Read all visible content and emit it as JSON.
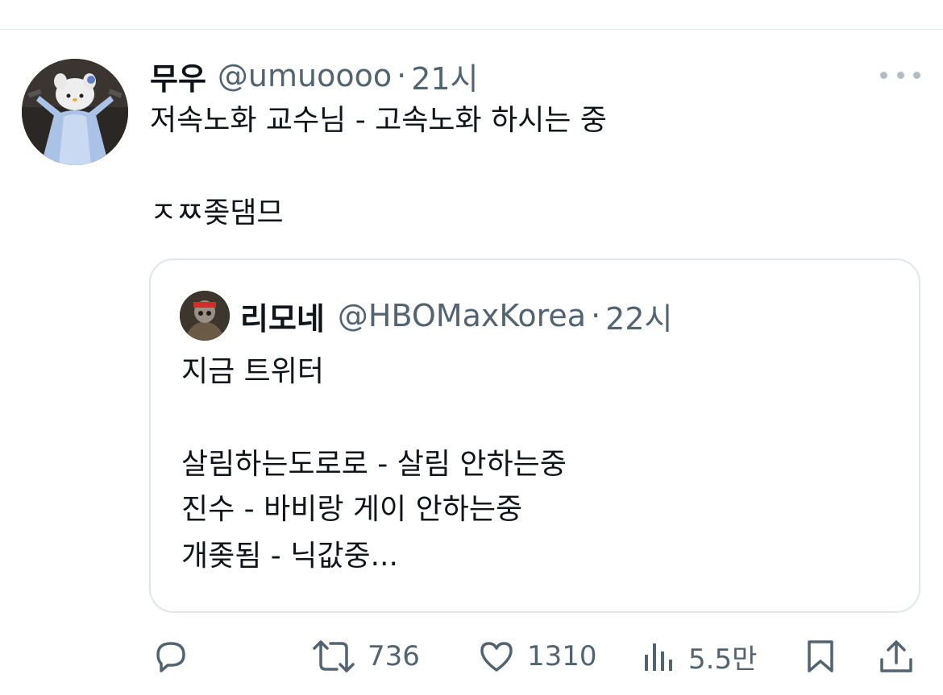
{
  "tweet": {
    "display_name": "무우",
    "handle": "@umuoooo",
    "separator": "·",
    "time": "21시",
    "text_line1": "저속노화 교수님 - 고속노화 하시는 중",
    "text_line2": "ㅈㅉ좆댐므"
  },
  "quote": {
    "display_name": "리모네",
    "handle": "@HBOMaxKorea",
    "separator": "·",
    "time": "22시",
    "lines": [
      "지금 트위터",
      "살림하는도로로 - 살림 안하는중",
      "진수 - 바비랑 게이 안하는중",
      "개좆됨 - 닉값중..."
    ]
  },
  "actions": {
    "reply_icon": "reply-icon",
    "retweet_icon": "retweet-icon",
    "retweet_count": "736",
    "like_icon": "heart-icon",
    "like_count": "1310",
    "views_icon": "bar-chart-icon",
    "views_count": "5.5만",
    "bookmark_icon": "bookmark-icon",
    "share_icon": "share-icon"
  },
  "colors": {
    "text_primary": "#0f1419",
    "text_secondary": "#536471",
    "border": "#e1e6ea"
  }
}
